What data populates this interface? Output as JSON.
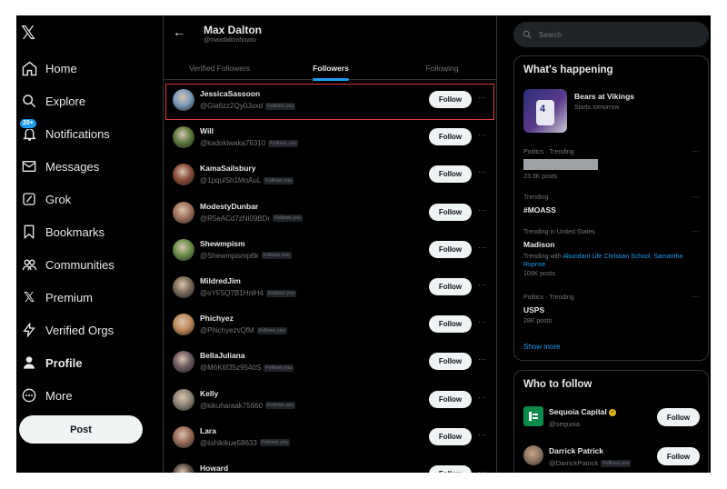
{
  "sidebar": {
    "items": [
      {
        "label": "Home",
        "icon": "home-icon"
      },
      {
        "label": "Explore",
        "icon": "search-icon"
      },
      {
        "label": "Notifications",
        "icon": "bell-icon",
        "badge": "20+"
      },
      {
        "label": "Messages",
        "icon": "envelope-icon"
      },
      {
        "label": "Grok",
        "icon": "grok-icon"
      },
      {
        "label": "Bookmarks",
        "icon": "bookmark-icon"
      },
      {
        "label": "Communities",
        "icon": "people-icon"
      },
      {
        "label": "Premium",
        "icon": "x-logo-icon"
      },
      {
        "label": "Verified Orgs",
        "icon": "lightning-icon"
      },
      {
        "label": "Profile",
        "icon": "person-icon",
        "active": true
      },
      {
        "label": "More",
        "icon": "more-circle-icon"
      }
    ],
    "post_label": "Post"
  },
  "header": {
    "name": "Max Dalton",
    "handle": "@maxdaltonhowto"
  },
  "tabs": [
    "Verified Followers",
    "Followers",
    "Following"
  ],
  "active_tab": "Followers",
  "follow_label": "Follow",
  "follows_you_label": "Follows you",
  "followers": [
    {
      "name": "JessicaSassoon",
      "handle": "@Gia6zz2Qy0Juxd",
      "follows_you": true,
      "highlighted": true,
      "avatar_color": "#7a9bbd"
    },
    {
      "name": "Will",
      "handle": "@kadokiwaka76310",
      "follows_you": true,
      "avatar_color": "#5f7a3e"
    },
    {
      "name": "KamaSailsbury",
      "handle": "@1pqulSh1MoAuL",
      "follows_you": true,
      "avatar_color": "#8a4d3a"
    },
    {
      "name": "ModestyDunbar",
      "handle": "@R5eACd7zNl09BDr",
      "follows_you": true,
      "avatar_color": "#a4735c"
    },
    {
      "name": "Shewmpism",
      "handle": "@Shewmpismp6k",
      "follows_you": true,
      "avatar_color": "#6b8f4a"
    },
    {
      "name": "MildredJim",
      "handle": "@oYF5Q7B1HnlH4",
      "follows_you": true,
      "avatar_color": "#7b6a5a"
    },
    {
      "name": "Phichyez",
      "handle": "@PhichyezvQfM",
      "follows_you": true,
      "avatar_color": "#c08a5a"
    },
    {
      "name": "BellaJuliana",
      "handle": "@M6K6f35z9540S",
      "follows_you": true,
      "avatar_color": "#6e5b62"
    },
    {
      "name": "Kelly",
      "handle": "@kikuharaak75660",
      "follows_you": true,
      "avatar_color": "#8f8576"
    },
    {
      "name": "Lara",
      "handle": "@iishikikue58633",
      "follows_you": true,
      "avatar_color": "#9a6b58"
    },
    {
      "name": "Howard",
      "handle": "",
      "follows_you": false,
      "avatar_color": "#5a4a40"
    }
  ],
  "right": {
    "search_placeholder": "Search",
    "whats_happening": {
      "title": "What's happening",
      "event": {
        "title": "Bears at Vikings",
        "subtitle": "Starts tomorrow"
      },
      "trends": [
        {
          "meta": "Politics · Trending",
          "name": "",
          "redacted": true,
          "count": "23.3K posts"
        },
        {
          "meta": "Trending",
          "name": "#MOASS",
          "count": ""
        },
        {
          "meta": "Trending in United States",
          "name": "Madison",
          "trending_with_prefix": "Trending with ",
          "trending_with_links": "Abundant Life Christian School, Samantha Ruprise",
          "count": "109K posts"
        },
        {
          "meta": "Politics · Trending",
          "name": "USPS",
          "count": "28K posts"
        }
      ],
      "show_more": "Show more"
    },
    "who_to_follow": {
      "title": "Who to follow",
      "accounts": [
        {
          "name": "Sequoia Capital",
          "handle": "@sequoia",
          "verified": true,
          "avatar_color": "#0b8a4a"
        },
        {
          "name": "Darrick Patrick",
          "handle": "@DarrickPatrick",
          "follows_you": true,
          "avatar_color": "#7a6655"
        }
      ]
    }
  }
}
